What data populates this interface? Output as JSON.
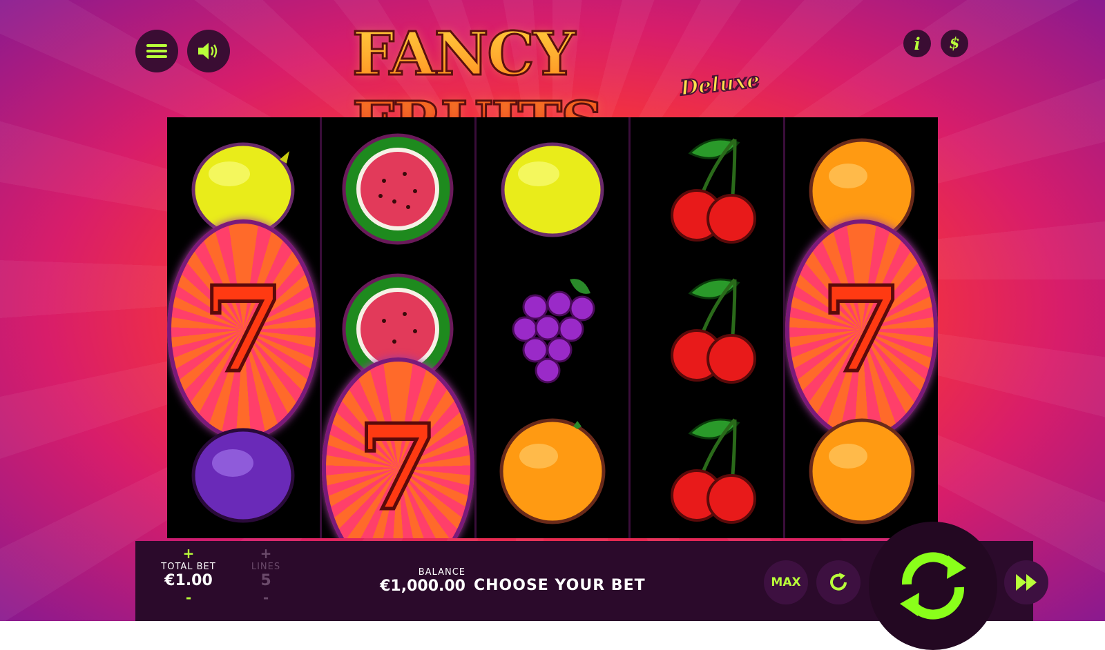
{
  "game": {
    "title_main": "FANCY FRUITS",
    "title_sub": "Deluxe"
  },
  "header": {
    "menu_icon": "hamburger-menu-icon",
    "sound_icon": "speaker-icon",
    "info_label": "i",
    "paytable_label": "$"
  },
  "reels": [
    [
      "lemon",
      "seven",
      "plum"
    ],
    [
      "watermelon",
      "watermelon",
      "seven"
    ],
    [
      "lemon",
      "grapes",
      "orange"
    ],
    [
      "cherries",
      "cherries",
      "cherries"
    ],
    [
      "orange",
      "seven",
      "orange"
    ]
  ],
  "controls": {
    "total_bet_label": "TOTAL BET",
    "total_bet_value": "€1.00",
    "lines_label": "LINES",
    "lines_value": "5",
    "plus": "+",
    "minus": "-",
    "balance_label": "BALANCE",
    "balance_value": "€1,000.00",
    "message": "CHOOSE YOUR BET",
    "max_label": "MAX"
  },
  "colors": {
    "accent": "#b9ff3a",
    "panel": "#2b0a2b"
  }
}
